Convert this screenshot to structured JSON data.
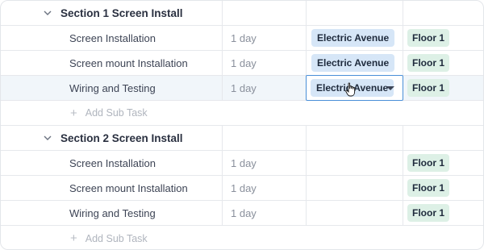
{
  "section1": {
    "title": "Section 1 Screen Install",
    "tasks": [
      {
        "name": "Screen Installation",
        "duration": "1 day",
        "location": "Electric Avenue",
        "floor": "Floor 1"
      },
      {
        "name": "Screen mount Installation",
        "duration": "1 day",
        "location": "Electric Avenue",
        "floor": "Floor 1"
      },
      {
        "name": "Wiring and Testing",
        "duration": "1 day",
        "location": "Electric Avenue",
        "floor": "Floor 1"
      }
    ],
    "add_label": "Add Sub Task"
  },
  "section2": {
    "title": "Section 2 Screen Install",
    "tasks": [
      {
        "name": "Screen Installation",
        "duration": "1 day",
        "floor": "Floor 1"
      },
      {
        "name": "Screen mount Installation",
        "duration": "1 day",
        "floor": "Floor 1"
      },
      {
        "name": "Wiring and Testing",
        "duration": "1 day",
        "floor": "Floor 1"
      }
    ],
    "add_label": "Add Sub Task"
  },
  "icons": {
    "expand": "chevron-down-icon",
    "add": "plus-icon",
    "dropdown": "caret-down-icon",
    "cursor": "hand-cursor-icon"
  },
  "colors": {
    "location_pill": "#d6e6f7",
    "floor_pill": "#ddf0e6",
    "focus_border": "#4a8fd8",
    "highlight_row": "#f1f6fa"
  }
}
